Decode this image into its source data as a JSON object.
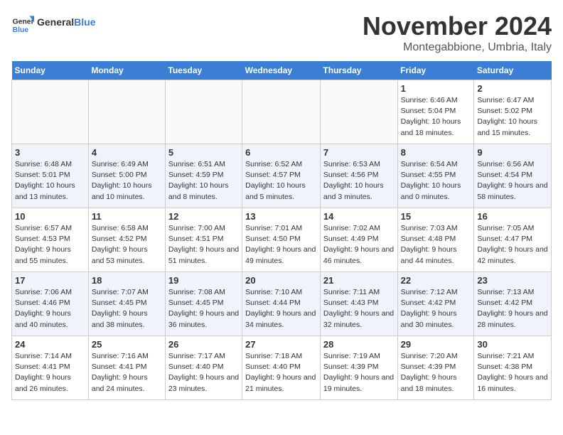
{
  "logo": {
    "text_general": "General",
    "text_blue": "Blue"
  },
  "title": "November 2024",
  "location": "Montegabbione, Umbria, Italy",
  "weekdays": [
    "Sunday",
    "Monday",
    "Tuesday",
    "Wednesday",
    "Thursday",
    "Friday",
    "Saturday"
  ],
  "weeks": [
    [
      {
        "day": "",
        "info": ""
      },
      {
        "day": "",
        "info": ""
      },
      {
        "day": "",
        "info": ""
      },
      {
        "day": "",
        "info": ""
      },
      {
        "day": "",
        "info": ""
      },
      {
        "day": "1",
        "info": "Sunrise: 6:46 AM\nSunset: 5:04 PM\nDaylight: 10 hours and 18 minutes."
      },
      {
        "day": "2",
        "info": "Sunrise: 6:47 AM\nSunset: 5:02 PM\nDaylight: 10 hours and 15 minutes."
      }
    ],
    [
      {
        "day": "3",
        "info": "Sunrise: 6:48 AM\nSunset: 5:01 PM\nDaylight: 10 hours and 13 minutes."
      },
      {
        "day": "4",
        "info": "Sunrise: 6:49 AM\nSunset: 5:00 PM\nDaylight: 10 hours and 10 minutes."
      },
      {
        "day": "5",
        "info": "Sunrise: 6:51 AM\nSunset: 4:59 PM\nDaylight: 10 hours and 8 minutes."
      },
      {
        "day": "6",
        "info": "Sunrise: 6:52 AM\nSunset: 4:57 PM\nDaylight: 10 hours and 5 minutes."
      },
      {
        "day": "7",
        "info": "Sunrise: 6:53 AM\nSunset: 4:56 PM\nDaylight: 10 hours and 3 minutes."
      },
      {
        "day": "8",
        "info": "Sunrise: 6:54 AM\nSunset: 4:55 PM\nDaylight: 10 hours and 0 minutes."
      },
      {
        "day": "9",
        "info": "Sunrise: 6:56 AM\nSunset: 4:54 PM\nDaylight: 9 hours and 58 minutes."
      }
    ],
    [
      {
        "day": "10",
        "info": "Sunrise: 6:57 AM\nSunset: 4:53 PM\nDaylight: 9 hours and 55 minutes."
      },
      {
        "day": "11",
        "info": "Sunrise: 6:58 AM\nSunset: 4:52 PM\nDaylight: 9 hours and 53 minutes."
      },
      {
        "day": "12",
        "info": "Sunrise: 7:00 AM\nSunset: 4:51 PM\nDaylight: 9 hours and 51 minutes."
      },
      {
        "day": "13",
        "info": "Sunrise: 7:01 AM\nSunset: 4:50 PM\nDaylight: 9 hours and 49 minutes."
      },
      {
        "day": "14",
        "info": "Sunrise: 7:02 AM\nSunset: 4:49 PM\nDaylight: 9 hours and 46 minutes."
      },
      {
        "day": "15",
        "info": "Sunrise: 7:03 AM\nSunset: 4:48 PM\nDaylight: 9 hours and 44 minutes."
      },
      {
        "day": "16",
        "info": "Sunrise: 7:05 AM\nSunset: 4:47 PM\nDaylight: 9 hours and 42 minutes."
      }
    ],
    [
      {
        "day": "17",
        "info": "Sunrise: 7:06 AM\nSunset: 4:46 PM\nDaylight: 9 hours and 40 minutes."
      },
      {
        "day": "18",
        "info": "Sunrise: 7:07 AM\nSunset: 4:45 PM\nDaylight: 9 hours and 38 minutes."
      },
      {
        "day": "19",
        "info": "Sunrise: 7:08 AM\nSunset: 4:45 PM\nDaylight: 9 hours and 36 minutes."
      },
      {
        "day": "20",
        "info": "Sunrise: 7:10 AM\nSunset: 4:44 PM\nDaylight: 9 hours and 34 minutes."
      },
      {
        "day": "21",
        "info": "Sunrise: 7:11 AM\nSunset: 4:43 PM\nDaylight: 9 hours and 32 minutes."
      },
      {
        "day": "22",
        "info": "Sunrise: 7:12 AM\nSunset: 4:42 PM\nDaylight: 9 hours and 30 minutes."
      },
      {
        "day": "23",
        "info": "Sunrise: 7:13 AM\nSunset: 4:42 PM\nDaylight: 9 hours and 28 minutes."
      }
    ],
    [
      {
        "day": "24",
        "info": "Sunrise: 7:14 AM\nSunset: 4:41 PM\nDaylight: 9 hours and 26 minutes."
      },
      {
        "day": "25",
        "info": "Sunrise: 7:16 AM\nSunset: 4:41 PM\nDaylight: 9 hours and 24 minutes."
      },
      {
        "day": "26",
        "info": "Sunrise: 7:17 AM\nSunset: 4:40 PM\nDaylight: 9 hours and 23 minutes."
      },
      {
        "day": "27",
        "info": "Sunrise: 7:18 AM\nSunset: 4:40 PM\nDaylight: 9 hours and 21 minutes."
      },
      {
        "day": "28",
        "info": "Sunrise: 7:19 AM\nSunset: 4:39 PM\nDaylight: 9 hours and 19 minutes."
      },
      {
        "day": "29",
        "info": "Sunrise: 7:20 AM\nSunset: 4:39 PM\nDaylight: 9 hours and 18 minutes."
      },
      {
        "day": "30",
        "info": "Sunrise: 7:21 AM\nSunset: 4:38 PM\nDaylight: 9 hours and 16 minutes."
      }
    ]
  ]
}
